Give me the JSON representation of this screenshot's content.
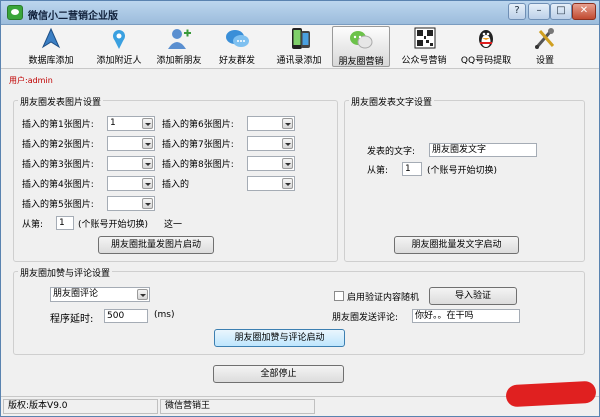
{
  "window": {
    "title": "微信小二营销企业版"
  },
  "titlebar": {
    "help": "?",
    "minimize": "–",
    "maximize": "□",
    "close": "✕"
  },
  "toolbar": {
    "items": [
      {
        "label": "数据库添加",
        "icon": "database-icon"
      },
      {
        "label": "添加附近人",
        "icon": "location-pin-icon"
      },
      {
        "label": "添加新朋友",
        "icon": "add-friend-icon"
      },
      {
        "label": "好友群发",
        "icon": "chat-bubbles-icon"
      },
      {
        "label": "通讯录添加",
        "icon": "phone-icon"
      },
      {
        "label": "朋友圈营销",
        "icon": "moments-icon"
      },
      {
        "label": "公众号营销",
        "icon": "qrcode-icon"
      },
      {
        "label": "QQ号码提取",
        "icon": "qq-penguin-icon"
      },
      {
        "label": "设置",
        "icon": "tools-icon"
      }
    ]
  },
  "user": {
    "label": "用户:",
    "name": "admin"
  },
  "image_group": {
    "title": "朋友圈发表图片设置",
    "left_labels": [
      "插入的第1张图片:",
      "插入的第2张图片:",
      "插入的第3张图片:",
      "插入的第4张图片:",
      "插入的第5张图片:"
    ],
    "left_values": [
      "1",
      "",
      "",
      "",
      ""
    ],
    "right_labels": [
      "插入的第6张图片:",
      "插入的第7张图片:",
      "插入的第8张图片:",
      "插入的"
    ],
    "from_label": "从第:",
    "from_value": "1",
    "from_hint": "(个账号开始切换)",
    "from_hint_tail": "这一",
    "start_button": "朋友圈批量发图片启动"
  },
  "text_group": {
    "title": "朋友圈发表文字设置",
    "text_label": "发表的文字:",
    "text_value": "朋友圈发文字",
    "from_label": "从第:",
    "from_value": "1",
    "from_hint": "(个账号开始切换)",
    "start_button": "朋友圈批量发文字启动"
  },
  "like_group": {
    "title": "朋友圈加赞与评论设置",
    "mode_value": "朋友圈评论",
    "delay_label": "程序延时:",
    "delay_value": "500",
    "delay_unit": "(ms)",
    "random_label": "启用验证内容随机",
    "import_button": "导入验证",
    "comment_label": "朋友圈发送评论:",
    "comment_value": "你好。。在干吗",
    "start_button": "朋友圈加赞与评论启动"
  },
  "stop_button": "全部停止",
  "status": {
    "version": "版权:版本V9.0",
    "brand": "微信营销王"
  },
  "colors": {
    "user_red": "#c00000",
    "titlebar": "#9cbcdc",
    "redaction": "#e02020"
  }
}
